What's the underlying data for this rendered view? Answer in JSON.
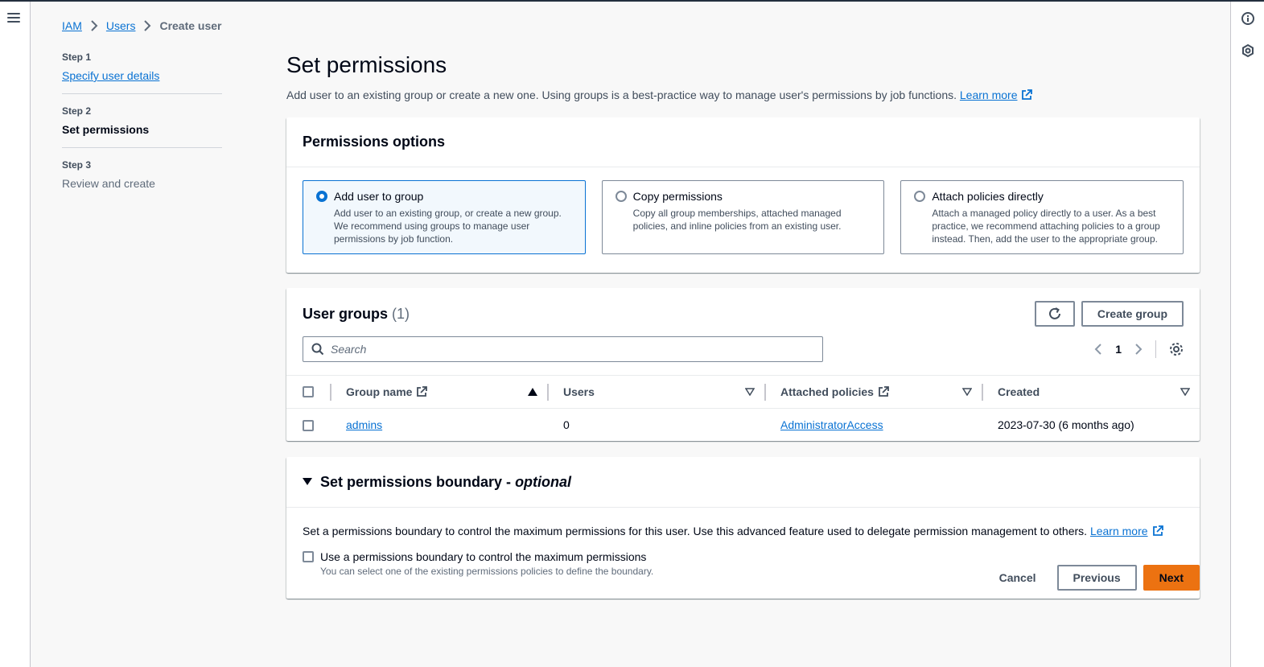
{
  "nav": {
    "menu_icon": "hamburger-menu-icon"
  },
  "right_rail": {
    "icons": [
      "info-icon",
      "settings-hex-icon"
    ]
  },
  "breadcrumb": {
    "items": [
      "IAM",
      "Users"
    ],
    "current": "Create user"
  },
  "steps": [
    {
      "num": "Step 1",
      "title": "Specify user details",
      "state": "link"
    },
    {
      "num": "Step 2",
      "title": "Set permissions",
      "state": "active"
    },
    {
      "num": "Step 3",
      "title": "Review and create",
      "state": "disabled"
    }
  ],
  "page": {
    "title": "Set permissions",
    "description": "Add user to an existing group or create a new one. Using groups is a best-practice way to manage user's permissions by job functions.",
    "learn_more": "Learn more"
  },
  "permissions_options": {
    "title": "Permissions options",
    "tiles": [
      {
        "title": "Add user to group",
        "desc": "Add user to an existing group, or create a new group. We recommend using groups to manage user permissions by job function.",
        "selected": true
      },
      {
        "title": "Copy permissions",
        "desc": "Copy all group memberships, attached managed policies, and inline policies from an existing user.",
        "selected": false
      },
      {
        "title": "Attach policies directly",
        "desc": "Attach a managed policy directly to a user. As a best practice, we recommend attaching policies to a group instead. Then, add the user to the appropriate group.",
        "selected": false
      }
    ]
  },
  "user_groups": {
    "title": "User groups",
    "count": "(1)",
    "create_button": "Create group",
    "search_placeholder": "Search",
    "page": "1",
    "columns": [
      "Group name",
      "Users",
      "Attached policies",
      "Created"
    ],
    "rows": [
      {
        "group_name": "admins",
        "users": "0",
        "policies": "AdministratorAccess",
        "created": "2023-07-30 (6 months ago)"
      }
    ]
  },
  "boundary": {
    "title": "Set permissions boundary - ",
    "title_em": "optional",
    "text": "Set a permissions boundary to control the maximum permissions for this user. Use this advanced feature used to delegate permission management to others.",
    "learn_more": "Learn more",
    "checkbox_label": "Use a permissions boundary to control the maximum permissions",
    "checkbox_hint": "You can select one of the existing permissions policies to define the boundary."
  },
  "footer": {
    "cancel": "Cancel",
    "previous": "Previous",
    "next": "Next"
  },
  "colors": {
    "link": "#0972d3",
    "primary": "#ec7211",
    "selected_bg": "#f2f8fd"
  }
}
